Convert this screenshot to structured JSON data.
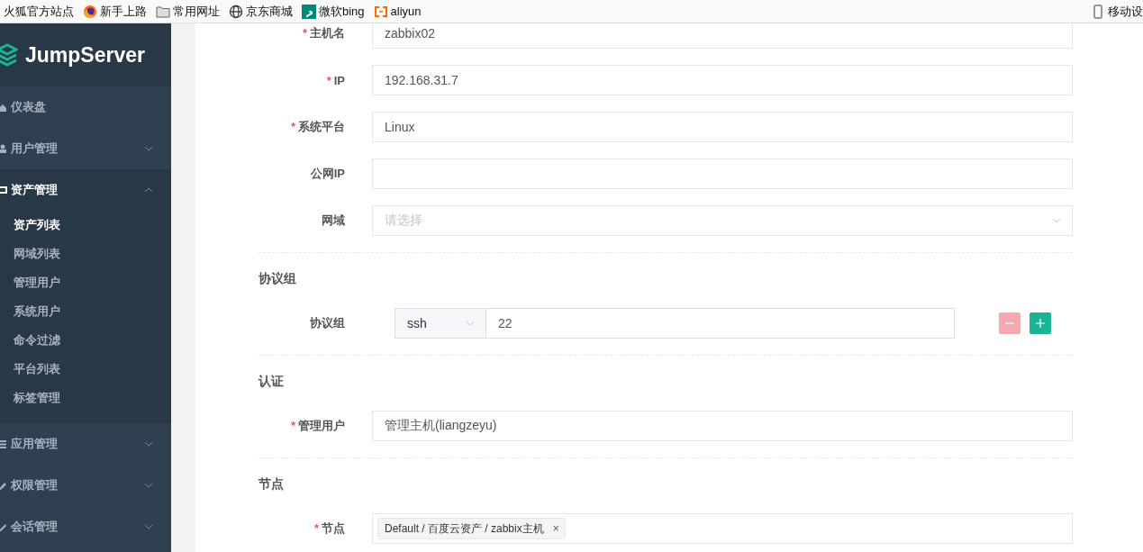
{
  "bookmarks": [
    {
      "label": "火狐官方站点",
      "kind": "none"
    },
    {
      "label": "新手上路",
      "kind": "firefox"
    },
    {
      "label": "常用网址",
      "kind": "folder"
    },
    {
      "label": "京东商城",
      "kind": "globe"
    },
    {
      "label": "微软bing",
      "kind": "bing"
    },
    {
      "label": "aliyun",
      "kind": "aliyun"
    }
  ],
  "bookmark_right": {
    "label": "移动设",
    "kind": "phone"
  },
  "sidebar": {
    "brand": "JumpServer",
    "items": [
      {
        "label": "仪表盘",
        "kind": "link",
        "expanded": false
      },
      {
        "label": "用户管理",
        "kind": "group",
        "expanded": false
      },
      {
        "label": "资产管理",
        "kind": "group",
        "expanded": true,
        "children": [
          {
            "label": "资产列表",
            "selected": true
          },
          {
            "label": "网域列表",
            "selected": false
          },
          {
            "label": "管理用户",
            "selected": false
          },
          {
            "label": "系统用户",
            "selected": false
          },
          {
            "label": "命令过滤",
            "selected": false
          },
          {
            "label": "平台列表",
            "selected": false
          },
          {
            "label": "标签管理",
            "selected": false
          }
        ]
      },
      {
        "label": "应用管理",
        "kind": "group",
        "expanded": false
      },
      {
        "label": "权限管理",
        "kind": "group",
        "expanded": false
      },
      {
        "label": "会话管理",
        "kind": "group",
        "expanded": false
      }
    ]
  },
  "form": {
    "sections": [
      {
        "fields": [
          {
            "kind": "input",
            "label": "主机名",
            "required_mark": "*",
            "value": "zabbix02"
          },
          {
            "kind": "input",
            "label": "IP",
            "required_mark": "*",
            "value": "192.168.31.7"
          },
          {
            "kind": "input",
            "label": "系统平台",
            "required_mark": "*",
            "value": "Linux"
          },
          {
            "kind": "input",
            "label": "公网IP"
          },
          {
            "kind": "select",
            "label": "网域",
            "placeholder": "请选择"
          }
        ]
      },
      {
        "heading": "协议组",
        "fields": [
          {
            "kind": "protocol",
            "label": "协议组",
            "protocol": "ssh",
            "port": "22",
            "buttons": [
              {
                "kind": "remove",
                "disabled": true
              },
              {
                "kind": "add",
                "disabled": false
              }
            ]
          }
        ]
      },
      {
        "heading": "认证",
        "fields": [
          {
            "kind": "input",
            "label": "管理用户",
            "required_mark": "*",
            "value": "管理主机(liangzeyu)"
          }
        ]
      },
      {
        "heading": "节点",
        "fields": [
          {
            "kind": "tags",
            "label": "节点",
            "required_mark": "*",
            "tags": [
              {
                "label": "Default / 百度云资产 / zabbix主机",
                "close": "×"
              }
            ]
          }
        ]
      }
    ]
  }
}
